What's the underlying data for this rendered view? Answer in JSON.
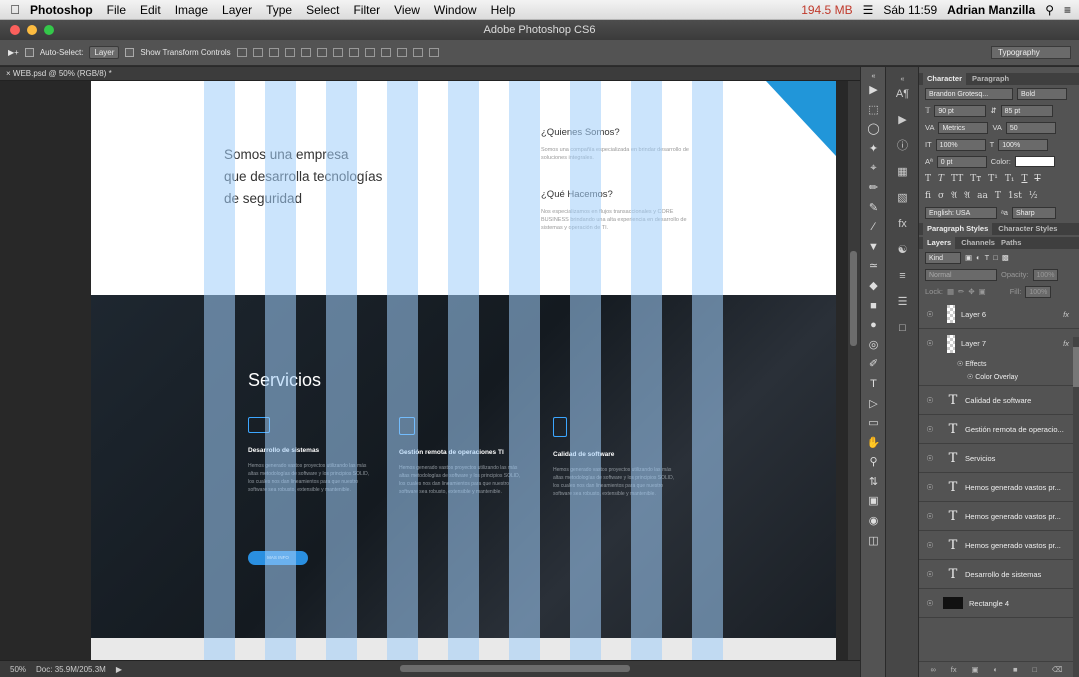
{
  "menubar": {
    "app": "Photoshop",
    "items": [
      "File",
      "Edit",
      "Image",
      "Layer",
      "Type",
      "Select",
      "Filter",
      "View",
      "Window",
      "Help"
    ],
    "memory": "194.5 MB",
    "clock": "Sáb 11:59",
    "user": "Adrian Manzilla"
  },
  "window": {
    "title": "Adobe Photoshop CS6"
  },
  "options": {
    "auto_select": "Auto-Select:",
    "auto_select_value": "Layer",
    "show_transform": "Show Transform Controls",
    "workspace": "Typography"
  },
  "document": {
    "tab": "WEB.psd @ 50% (RGB/8) *"
  },
  "canvas": {
    "hero_lines": [
      "Somos una empresa",
      "que desarrolla tecnologías",
      "de seguridad"
    ],
    "q1": "¿Quienes Somos?",
    "p1": "Somos una compañía especializada en brindar desarrollo de soluciones integrales.",
    "q2": "¿Qué Hacemos?",
    "p2": "Nos especializamos en flujos transaccionales y CORE BUSINESS brindando una alta experiencia en desarrollo de sistemas y operación de TI.",
    "services_title": "Servicios",
    "services": [
      {
        "title": "Desarrollo de sistemas",
        "desc": "Hemos generado vastos proyectos utilizando las más altas metodologías de software y los principios SOLID, los cuales nos dan lineamientos para que nuestro software sea robusto, extensible y mantenible."
      },
      {
        "title": "Gestión remota de operaciones TI",
        "desc": "Hemos generado vastos proyectos utilizando las más altas metodologías de software y los principios SOLID, los cuales nos dan lineamientos para que nuestro software sea robusto, extensible y mantenible."
      },
      {
        "title": "Calidad de software",
        "desc": "Hemos generado vastos proyectos utilizando las más altas metodologías de software y los principios SOLID, los cuales nos dan lineamientos para que nuestro software sea robusto, extensible y mantenible."
      }
    ],
    "button": "MAS INFO"
  },
  "status": {
    "zoom": "50%",
    "doc": "Doc: 35.9M/205.3M"
  },
  "character": {
    "tabs": [
      "Character",
      "Paragraph"
    ],
    "font": "Brandon Grotesq...",
    "style": "Bold",
    "size": "90 pt",
    "leading": "85 pt",
    "kerning": "Metrics",
    "tracking": "50",
    "vscale": "100%",
    "hscale": "100%",
    "baseline": "0 pt",
    "color_label": "Color:",
    "language": "English: USA",
    "aa": "Sharp"
  },
  "pstyles": {
    "tabs": [
      "Paragraph Styles",
      "Character Styles"
    ]
  },
  "layers": {
    "tabs": [
      "Layers",
      "Channels",
      "Paths"
    ],
    "kind": "Kind",
    "blend": "Normal",
    "opacity_label": "Opacity:",
    "opacity": "100%",
    "lock_label": "Lock:",
    "fill_label": "Fill:",
    "fill": "100%",
    "effects": "Effects",
    "color_overlay": "Color Overlay",
    "items": [
      "Layer 6",
      "Layer 7",
      "Calidad de software",
      "Gestión remota de operacio...",
      "Servicios",
      "Hemos generado vastos pr...",
      "Hemos generado vastos pr...",
      "Hemos generado vastos pr...",
      "Desarrollo de sistemas",
      "Rectangle 4"
    ]
  }
}
